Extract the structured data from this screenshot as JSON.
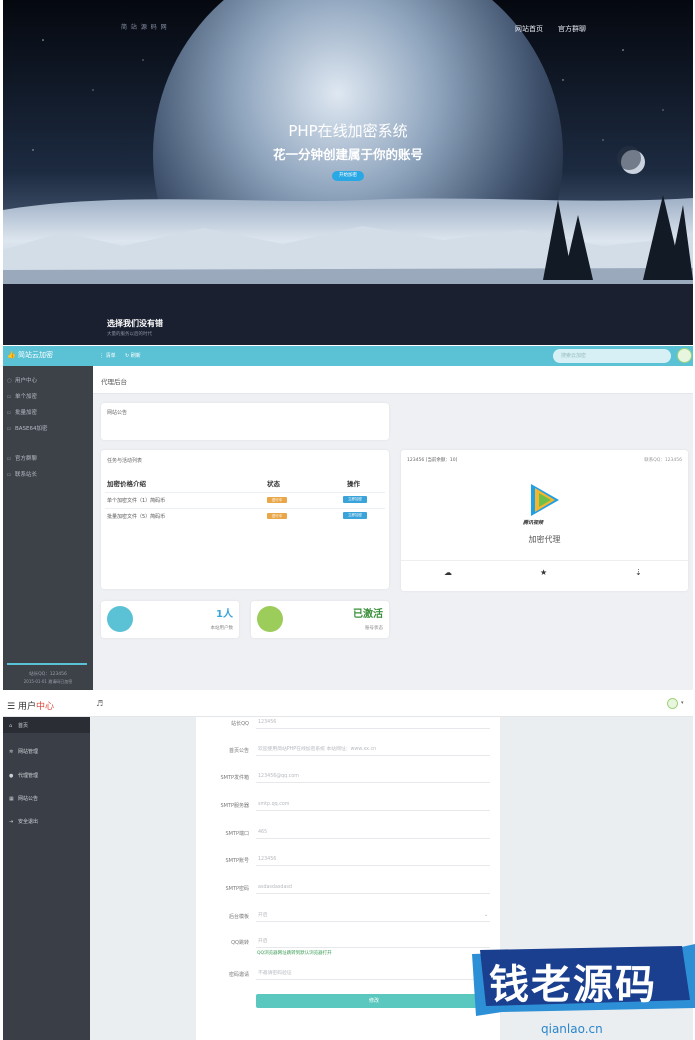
{
  "hero": {
    "logo_text": "简 站 源 码 网",
    "nav": [
      "网站首页",
      "官方群聊"
    ],
    "title": "PHP在线加密系统",
    "subtitle": "花一分钟创建属于你的账号",
    "button": "开始加密",
    "bottom_title": "选择我们没有错",
    "bottom_sub": "大量的服务以后的时代"
  },
  "agent": {
    "brand": "简站云加密",
    "menu": [
      "清单",
      "刷新"
    ],
    "search_placeholder": "搜索云加密",
    "sidebar": [
      {
        "icon": "user-icon",
        "label": "用户中心"
      },
      {
        "icon": "file-icon",
        "label": "单个加密"
      },
      {
        "icon": "files-icon",
        "label": "批量加密"
      },
      {
        "icon": "code-icon",
        "label": "BASE64加密"
      },
      {
        "icon": "group-icon",
        "label": "官方群聊"
      },
      {
        "icon": "contact-icon",
        "label": "联系站长"
      }
    ],
    "sidebar_footer": [
      "站长QQ：123456",
      "2015-01-01 邀请码已加密"
    ],
    "page_title": "代理后台",
    "announcement_label": "网站公告",
    "task_label": "任务与活动列表",
    "table": {
      "headers": [
        "加密价格介绍",
        "状态",
        "操作"
      ],
      "rows": [
        {
          "name": "单个加密文件（1）简码币",
          "status": "进行中",
          "action": "立即加密"
        },
        {
          "name": "批量加密文件（5）简码币",
          "status": "进行中",
          "action": "立即加密"
        }
      ]
    },
    "profile": {
      "left": "123456 [当前余额：10]",
      "right": "联系QQ：123456",
      "logo_text": "腾讯视频",
      "caption": "加密代理"
    },
    "stats": [
      {
        "value": "1人",
        "label": "本站用户数",
        "color": "#3aa3d9"
      },
      {
        "value": "已激活",
        "label": "账号状态",
        "color": "#3a8f3a"
      }
    ],
    "colors": {
      "accent": "#5bc2d6",
      "sidebar": "#3d4148"
    }
  },
  "user": {
    "brand_prefix": "用户",
    "brand_suffix": "中心",
    "note_icon": "♬",
    "sidebar": [
      {
        "icon": "home-icon",
        "label": "首页"
      },
      {
        "icon": "gear-icon",
        "label": "网站管理"
      },
      {
        "icon": "user-icon",
        "label": "代理管理"
      },
      {
        "icon": "grid-icon",
        "label": "网站公告"
      },
      {
        "icon": "logout-icon",
        "label": "安全退出"
      }
    ],
    "form": [
      {
        "label": "站长QQ",
        "value": "123456",
        "type": "input"
      },
      {
        "label": "首页公告",
        "value": "欢迎使用简站PHP在线加密系统 本站网址：www.xx.cn",
        "type": "input"
      },
      {
        "label": "SMTP发件箱",
        "value": "123456@qq.com",
        "type": "input"
      },
      {
        "label": "SMTP服务器",
        "value": "smtp.qq.com",
        "type": "input"
      },
      {
        "label": "SMTP端口",
        "value": "465",
        "type": "input"
      },
      {
        "label": "SMTP账号",
        "value": "123456",
        "type": "input"
      },
      {
        "label": "SMTP密码",
        "value": "asdasdasdasd",
        "type": "input"
      },
      {
        "label": "后台模板",
        "value": "开启",
        "type": "select"
      },
      {
        "label": "QQ跳转",
        "value": "开启",
        "type": "input"
      },
      {
        "label": "密码邀请",
        "value": "不邀请密码验证",
        "type": "input"
      }
    ],
    "qq_hint": "QQ浏览器网址跳转到默认浏览器打开",
    "submit": "修改"
  },
  "watermark": {
    "text": "钱老源码",
    "url": "qianlao.cn"
  }
}
